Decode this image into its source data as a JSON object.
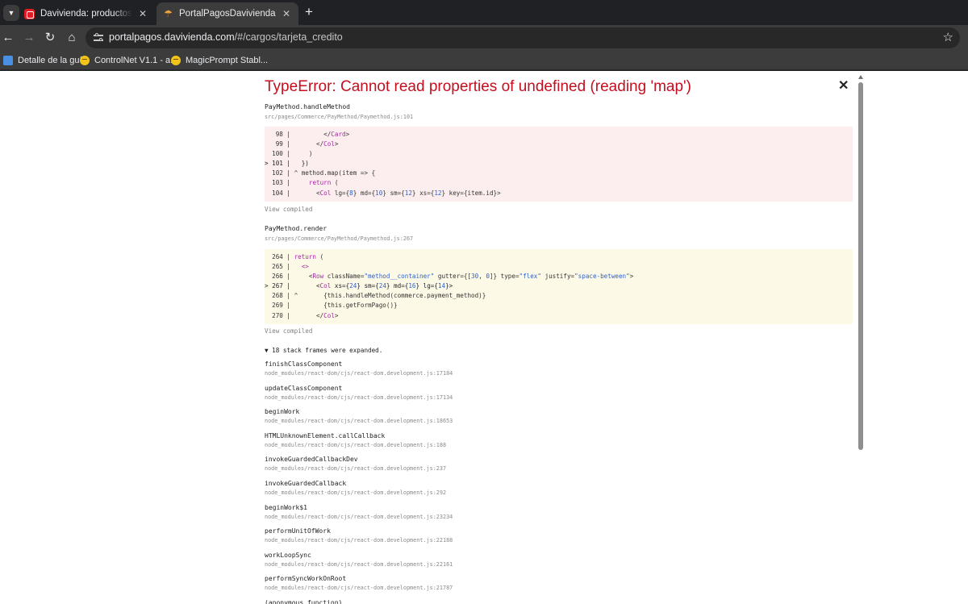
{
  "browser": {
    "tabs": [
      {
        "title": "Davivienda: productos y servicios",
        "favicon": "davivienda-logo-icon",
        "active": false
      },
      {
        "title": "PortalPagosDavivienda | Index",
        "favicon": "umbrella-icon",
        "active": true
      }
    ],
    "url": {
      "host": "portalpagos.davivienda.com",
      "path": "/#/cargos/tarjeta_credito"
    },
    "bookmarks": [
      {
        "label": "Detalle de la guía",
        "icon": "guide-icon"
      },
      {
        "label": "ControlNet V1.1 - a...",
        "icon": "hugging-face-icon"
      },
      {
        "label": "MagicPrompt Stabl...",
        "icon": "hugging-face-icon"
      }
    ]
  },
  "error": {
    "title": "TypeError: Cannot read properties of undefined (reading 'map')",
    "frames_with_code": [
      {
        "name": "PayMethod.handleMethod",
        "location": "src/pages/Commerce/PayMethod/Paymethod.js:101",
        "lines": [
          "   98 |         </Card>",
          "   99 |       </Col>",
          "  100 |     )",
          "> 101 |   })",
          "  102 | ^ method.map(item => {",
          "  103 |     return (",
          "  104 |       <Col lg={8} md={10} sm={12} xs={12} key={item.id}>"
        ],
        "view_compiled": "View compiled"
      },
      {
        "name": "PayMethod.render",
        "location": "src/pages/Commerce/PayMethod/Paymethod.js:267",
        "lines": [
          "  264 | return (",
          "  265 |   <>",
          "  266 |     <Row className=\"method__container\" gutter={[30, 0]} type=\"flex\" justify=\"space-between\">",
          "> 267 |       <Col xs={24} sm={24} md={16} lg={14}>",
          "  268 | ^       {this.handleMethod(commerce.payment_method)}",
          "  269 |         {this.getFormPago()}",
          "  270 |       </Col>"
        ],
        "view_compiled": "View compiled"
      }
    ],
    "expanded_toggle": "▼ 18 stack frames were expanded.",
    "stack_frames": [
      {
        "name": "finishClassComponent",
        "location": "node_modules/react-dom/cjs/react-dom.development.js:17184"
      },
      {
        "name": "updateClassComponent",
        "location": "node_modules/react-dom/cjs/react-dom.development.js:17134"
      },
      {
        "name": "beginWork",
        "location": "node_modules/react-dom/cjs/react-dom.development.js:18653"
      },
      {
        "name": "HTMLUnknownElement.callCallback",
        "location": "node_modules/react-dom/cjs/react-dom.development.js:188"
      },
      {
        "name": "invokeGuardedCallbackDev",
        "location": "node_modules/react-dom/cjs/react-dom.development.js:237"
      },
      {
        "name": "invokeGuardedCallback",
        "location": "node_modules/react-dom/cjs/react-dom.development.js:292"
      },
      {
        "name": "beginWork$1",
        "location": "node_modules/react-dom/cjs/react-dom.development.js:23234"
      },
      {
        "name": "performUnitOfWork",
        "location": "node_modules/react-dom/cjs/react-dom.development.js:22188"
      },
      {
        "name": "workLoopSync",
        "location": "node_modules/react-dom/cjs/react-dom.development.js:22161"
      },
      {
        "name": "performSyncWorkOnRoot",
        "location": "node_modules/react-dom/cjs/react-dom.development.js:21787"
      },
      {
        "name": "(anonymous function)",
        "location": ""
      }
    ]
  },
  "colors": {
    "error_red": "#c40f1f",
    "code_bg_error": "#fceeee",
    "code_bg_warning": "#fdf9e7"
  }
}
